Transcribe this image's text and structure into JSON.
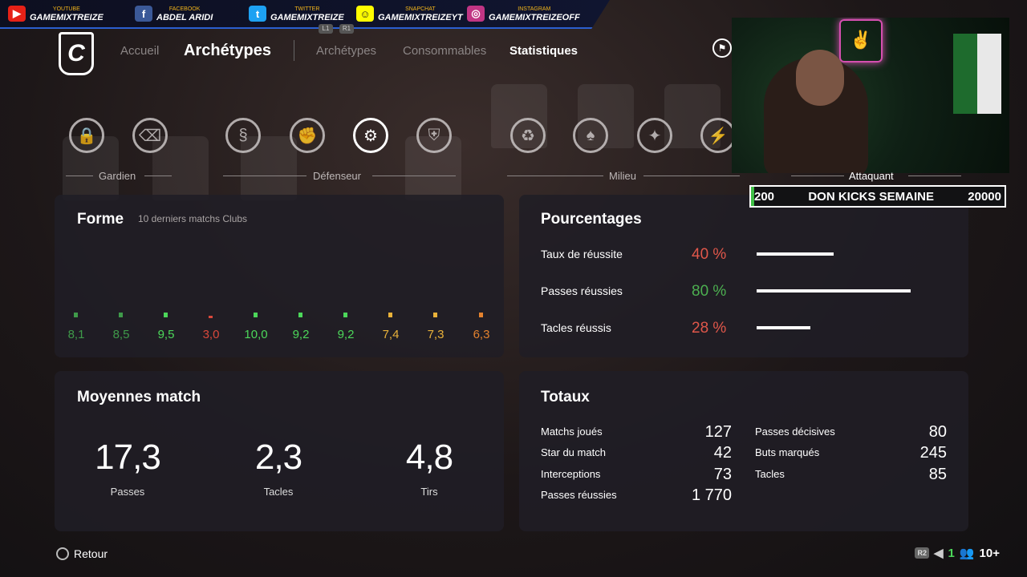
{
  "social": [
    {
      "network": "YOUTUBE",
      "name": "GAMEMIXTREIZE",
      "icon": "youtube-icon",
      "color": "#e62117"
    },
    {
      "network": "FACEBOOK",
      "name": "ABDEL ARIDI",
      "icon": "facebook-icon",
      "color": "#3b5998"
    },
    {
      "network": "TWITTER",
      "name": "GAMEMIXTREIZE",
      "icon": "twitter-icon",
      "color": "#1da1f2"
    },
    {
      "network": "SNAPCHAT",
      "name": "GAMEMIXTREIZEYT",
      "icon": "snapchat-icon",
      "color": "#fffc00"
    },
    {
      "network": "INSTAGRAM",
      "name": "GAMEMIXTREIZEOFF",
      "icon": "instagram-icon",
      "color": "#c13584"
    }
  ],
  "nav": {
    "logo": "C",
    "accueil": "Accueil",
    "title": "Archétypes",
    "badge_l1": "L1",
    "badge_r1": "R1",
    "tabs": [
      "Archétypes",
      "Consommables",
      "Statistiques"
    ],
    "active_tab": "Statistiques"
  },
  "categories": [
    "Gardien",
    "Défenseur",
    "Milieu",
    "Attaquant"
  ],
  "archetypes": [
    {
      "icon": "lock-shield-icon",
      "glyph": "🔒"
    },
    {
      "icon": "sweeper-icon",
      "glyph": "⌫"
    },
    {
      "icon": "spring-icon",
      "glyph": "§"
    },
    {
      "icon": "fist-icon",
      "glyph": "✊"
    },
    {
      "icon": "gears-ball-icon",
      "glyph": "⚙",
      "selected": true
    },
    {
      "icon": "shield-icon",
      "glyph": "⛨"
    },
    {
      "icon": "recycle-icon",
      "glyph": "♻"
    },
    {
      "icon": "tuxedo-icon",
      "glyph": "♠"
    },
    {
      "icon": "lightbulb-icon",
      "glyph": "✦"
    },
    {
      "icon": "lightning-icon",
      "glyph": "⚡"
    }
  ],
  "forme": {
    "title": "Forme",
    "subtitle": "10 derniers matchs Clubs",
    "ratings": [
      {
        "value": "8,1",
        "color": "#3f9a4a"
      },
      {
        "value": "8,5",
        "color": "#3f9a4a"
      },
      {
        "value": "9,5",
        "color": "#4cd75a"
      },
      {
        "value": "3,0",
        "color": "#d9483b"
      },
      {
        "value": "10,0",
        "color": "#4cd75a"
      },
      {
        "value": "9,2",
        "color": "#4cd75a"
      },
      {
        "value": "9,2",
        "color": "#4cd75a"
      },
      {
        "value": "7,4",
        "color": "#e9b23a"
      },
      {
        "value": "7,3",
        "color": "#e9b23a"
      },
      {
        "value": "6,3",
        "color": "#e4822e"
      }
    ]
  },
  "pourcentages": {
    "title": "Pourcentages",
    "rows": [
      {
        "label": "Taux de réussite",
        "value": "40 %",
        "fraction": 0.4,
        "color": "#e0574a"
      },
      {
        "label": "Passes réussies",
        "value": "80 %",
        "fraction": 0.8,
        "color": "#4caf50"
      },
      {
        "label": "Tacles réussis",
        "value": "28 %",
        "fraction": 0.28,
        "color": "#e0574a"
      }
    ]
  },
  "moyennes": {
    "title": "Moyennes match",
    "items": [
      {
        "value": "17,3",
        "label": "Passes"
      },
      {
        "value": "2,3",
        "label": "Tacles"
      },
      {
        "value": "4,8",
        "label": "Tirs"
      }
    ]
  },
  "totaux": {
    "title": "Totaux",
    "left": [
      {
        "label": "Matchs joués",
        "value": "127"
      },
      {
        "label": "Star du match",
        "value": "42"
      },
      {
        "label": "Interceptions",
        "value": "73"
      },
      {
        "label": "Passes réussies",
        "value": "1 770"
      }
    ],
    "right": [
      {
        "label": "Passes décisives",
        "value": "80"
      },
      {
        "label": "Buts marqués",
        "value": "245"
      },
      {
        "label": "Tacles",
        "value": "85"
      }
    ]
  },
  "ticker": {
    "left": "200",
    "center": "DON KICKS SEMAINE",
    "right": "20000"
  },
  "footer": {
    "back": "Retour",
    "r2": "R2",
    "count": "1",
    "players": "10+"
  }
}
